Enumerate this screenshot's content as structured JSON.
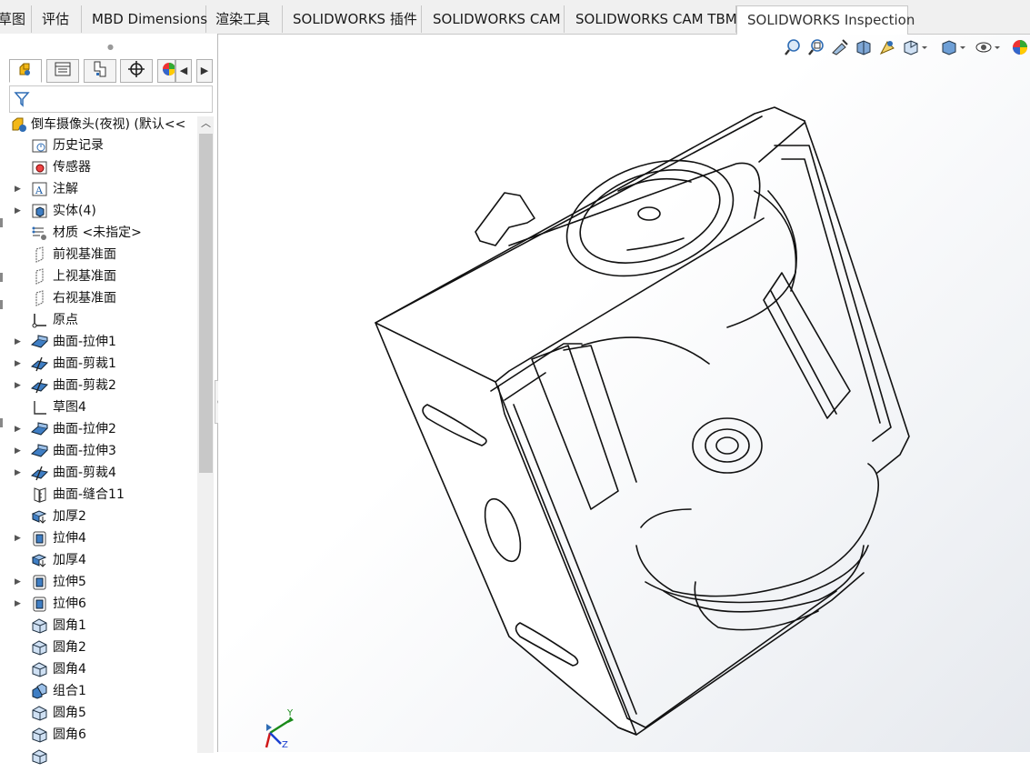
{
  "ribbon_tabs": [
    {
      "label": "草图"
    },
    {
      "label": "评估"
    },
    {
      "label": "MBD Dimensions"
    },
    {
      "label": "渲染工具"
    },
    {
      "label": "SOLIDWORKS 插件"
    },
    {
      "label": "SOLIDWORKS CAM"
    },
    {
      "label": "SOLIDWORKS CAM TBM"
    },
    {
      "label": "SOLIDWORKS Inspection"
    }
  ],
  "panel": {
    "tabs": [
      "feature-manager-icon",
      "property-manager-icon",
      "configuration-manager-icon",
      "dimxpert-icon",
      "display-manager-icon"
    ],
    "filter_icon": "filter-icon",
    "root": {
      "label": "倒车摄像头(夜视)  (默认<<",
      "icon": "part-icon"
    }
  },
  "tree": [
    {
      "label": "历史记录",
      "icon": "history-icon",
      "expandable": false
    },
    {
      "label": "传感器",
      "icon": "sensor-icon",
      "expandable": false
    },
    {
      "label": "注解",
      "icon": "annotation-icon",
      "expandable": true
    },
    {
      "label": "实体(4)",
      "icon": "solid-bodies-icon",
      "expandable": true
    },
    {
      "label": "材质 <未指定>",
      "icon": "material-icon",
      "expandable": false
    },
    {
      "label": "前视基准面",
      "icon": "plane-icon",
      "expandable": false
    },
    {
      "label": "上视基准面",
      "icon": "plane-icon",
      "expandable": false
    },
    {
      "label": "右视基准面",
      "icon": "plane-icon",
      "expandable": false
    },
    {
      "label": "原点",
      "icon": "origin-icon",
      "expandable": false
    },
    {
      "label": "曲面-拉伸1",
      "icon": "surface-extrude-icon",
      "expandable": true
    },
    {
      "label": "曲面-剪裁1",
      "icon": "surface-trim-icon",
      "expandable": true
    },
    {
      "label": "曲面-剪裁2",
      "icon": "surface-trim-icon",
      "expandable": true
    },
    {
      "label": "草图4",
      "icon": "sketch-icon",
      "expandable": false
    },
    {
      "label": "曲面-拉伸2",
      "icon": "surface-extrude-icon",
      "expandable": true
    },
    {
      "label": "曲面-拉伸3",
      "icon": "surface-extrude-icon",
      "expandable": true
    },
    {
      "label": "曲面-剪裁4",
      "icon": "surface-trim-icon",
      "expandable": true
    },
    {
      "label": "曲面-缝合11",
      "icon": "surface-knit-icon",
      "expandable": false
    },
    {
      "label": "加厚2",
      "icon": "thicken-icon",
      "expandable": false
    },
    {
      "label": "拉伸4",
      "icon": "extrude-icon",
      "expandable": true
    },
    {
      "label": "加厚4",
      "icon": "thicken-icon",
      "expandable": false
    },
    {
      "label": "拉伸5",
      "icon": "extrude-icon",
      "expandable": true
    },
    {
      "label": "拉伸6",
      "icon": "extrude-icon",
      "expandable": true
    },
    {
      "label": "圆角1",
      "icon": "fillet-icon",
      "expandable": false
    },
    {
      "label": "圆角2",
      "icon": "fillet-icon",
      "expandable": false
    },
    {
      "label": "圆角4",
      "icon": "fillet-icon",
      "expandable": false
    },
    {
      "label": "组合1",
      "icon": "combine-icon",
      "expandable": false
    },
    {
      "label": "圆角5",
      "icon": "fillet-icon",
      "expandable": false
    },
    {
      "label": "圆角6",
      "icon": "fillet-icon",
      "expandable": false
    },
    {
      "label": "",
      "icon": "fillet-icon",
      "expandable": false
    }
  ],
  "triad": {
    "y": "Y",
    "z": "Z"
  },
  "heads_up_toolbar": [
    "zoom-to-fit-icon",
    "zoom-to-area-icon",
    "previous-view-icon",
    "section-view-icon",
    "dynamic-annotation-icon",
    "view-orientation-icon",
    "display-style-icon",
    "hide-show-icon",
    "appearance-icon"
  ],
  "colors": {
    "accent": "#1f5fa8",
    "icon_blue": "#3f7ec4",
    "icon_yellow": "#f0b400",
    "triad_red": "#d01818",
    "triad_green": "#1a8a1a",
    "triad_blue": "#1a3fd0"
  }
}
